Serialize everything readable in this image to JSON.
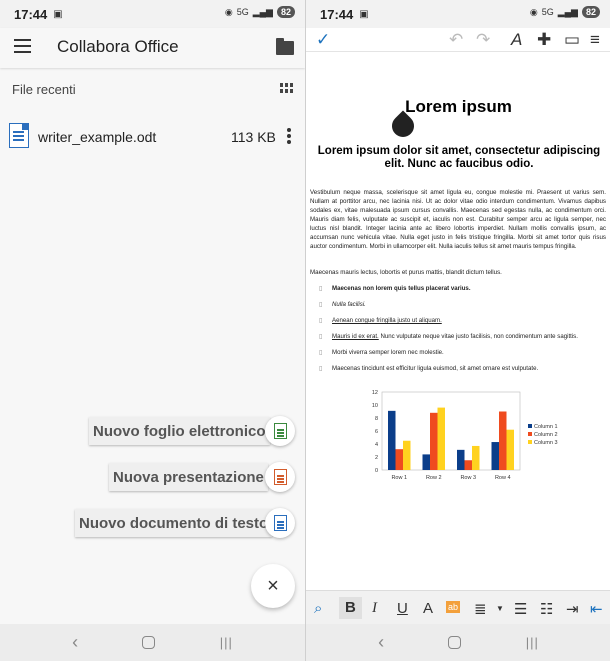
{
  "status_left": {
    "time": "17:44",
    "battery": "82",
    "signal": "5G"
  },
  "status_right": {
    "time": "17:44",
    "battery": "82",
    "signal": "5G"
  },
  "app": {
    "title": "Collabora Office"
  },
  "recent": {
    "section_title": "File recenti",
    "files": [
      {
        "name": "writer_example.odt",
        "size": "113 KB"
      }
    ]
  },
  "fab_menu": {
    "spreadsheet": "Nuovo foglio elettronico",
    "presentation": "Nuova presentazione",
    "text_document": "Nuovo documento di testo",
    "close": "×"
  },
  "colors": {
    "writer": "#2a6ebd",
    "calc": "#3b8a3e",
    "impress": "#d35c2c",
    "accent": "#1e73be"
  },
  "icons": {
    "menu": "hamburger-icon",
    "folder": "folder-icon",
    "grid": "grid-view-icon",
    "more": "kebab-menu-icon",
    "confirm": "checkmark-icon",
    "undo": "undo-icon",
    "redo": "redo-icon"
  },
  "editor": {
    "title": "Lorem ipsum",
    "subtitle": "Lorem ipsum dolor sit amet, consectetur adipiscing elit. Nunc ac faucibus odio.",
    "para1": "Vestibulum neque massa, scelerisque sit amet ligula eu, congue molestie mi. Praesent ut varius sem. Nullam at porttitor arcu, nec lacinia nisi. Ut ac dolor vitae odio interdum condimentum. Vivamus dapibus sodales ex, vitae malesuada ipsum cursus convallis. Maecenas sed egestas nulla, ac condimentum orci. Mauris diam felis, vulputate ac suscipit et, iaculis non est. Curabitur semper arcu ac ligula semper, nec luctus nisl blandit. Integer lacinia ante ac libero lobortis imperdiet. Nullam mollis convallis ipsum, ac accumsan nunc vehicula vitae. Nulla eget justo in felis tristique fringilla. Morbi sit amet tortor quis risus auctor condimentum. Morbi in ullamcorper elit. Nulla iaculis tellus sit amet mauris tempus fringilla.",
    "para2": "Maecenas mauris lectus, lobortis et purus mattis, blandit dictum tellus.",
    "list": [
      "Maecenas non lorem quis tellus placerat varius.",
      "Nulla facilisi.",
      "Aenean congue fringilla justo ut aliquam.",
      "Mauris id ex erat. Nunc vulputate neque vitae justo facilisis, non condimentum ante sagittis.",
      "Morbi viverra semper lorem nec molestie.",
      "Maecenas tincidunt est efficitur ligula euismod, sit amet ornare est vulputate."
    ],
    "list_bold_1": "Maecenas non lorem quis tellus placerat varius.",
    "list_italic_2": "Nulla facilisi.",
    "list_underline_3": "Aenean congue fringilla justo ut aliquam.",
    "list_under_4a": "Mauris id ex erat.",
    "list_4b": " Nunc vulputate neque vitae justo facilisis, non condimentum ante sagittis.",
    "list_5": "Morbi viverra semper lorem nec molestie.",
    "list_6": "Maecenas tincidunt est efficitur ligula euismod, sit amet ornare est vulputate."
  },
  "chart_data": {
    "type": "bar",
    "categories": [
      "Row 1",
      "Row 2",
      "Row 3",
      "Row 4"
    ],
    "series": [
      {
        "name": "Column 1",
        "values": [
          9.1,
          2.4,
          3.1,
          4.3
        ],
        "color": "#0b3e8a"
      },
      {
        "name": "Column 2",
        "values": [
          3.2,
          8.8,
          1.5,
          9.0
        ],
        "color": "#ef4b1f"
      },
      {
        "name": "Column 3",
        "values": [
          4.5,
          9.6,
          3.7,
          6.2
        ],
        "color": "#ffd21f"
      }
    ],
    "yticks": [
      "0",
      "2",
      "4",
      "6",
      "8",
      "10",
      "12"
    ],
    "ylim": [
      0,
      12
    ],
    "legend": "right",
    "grid": false
  }
}
